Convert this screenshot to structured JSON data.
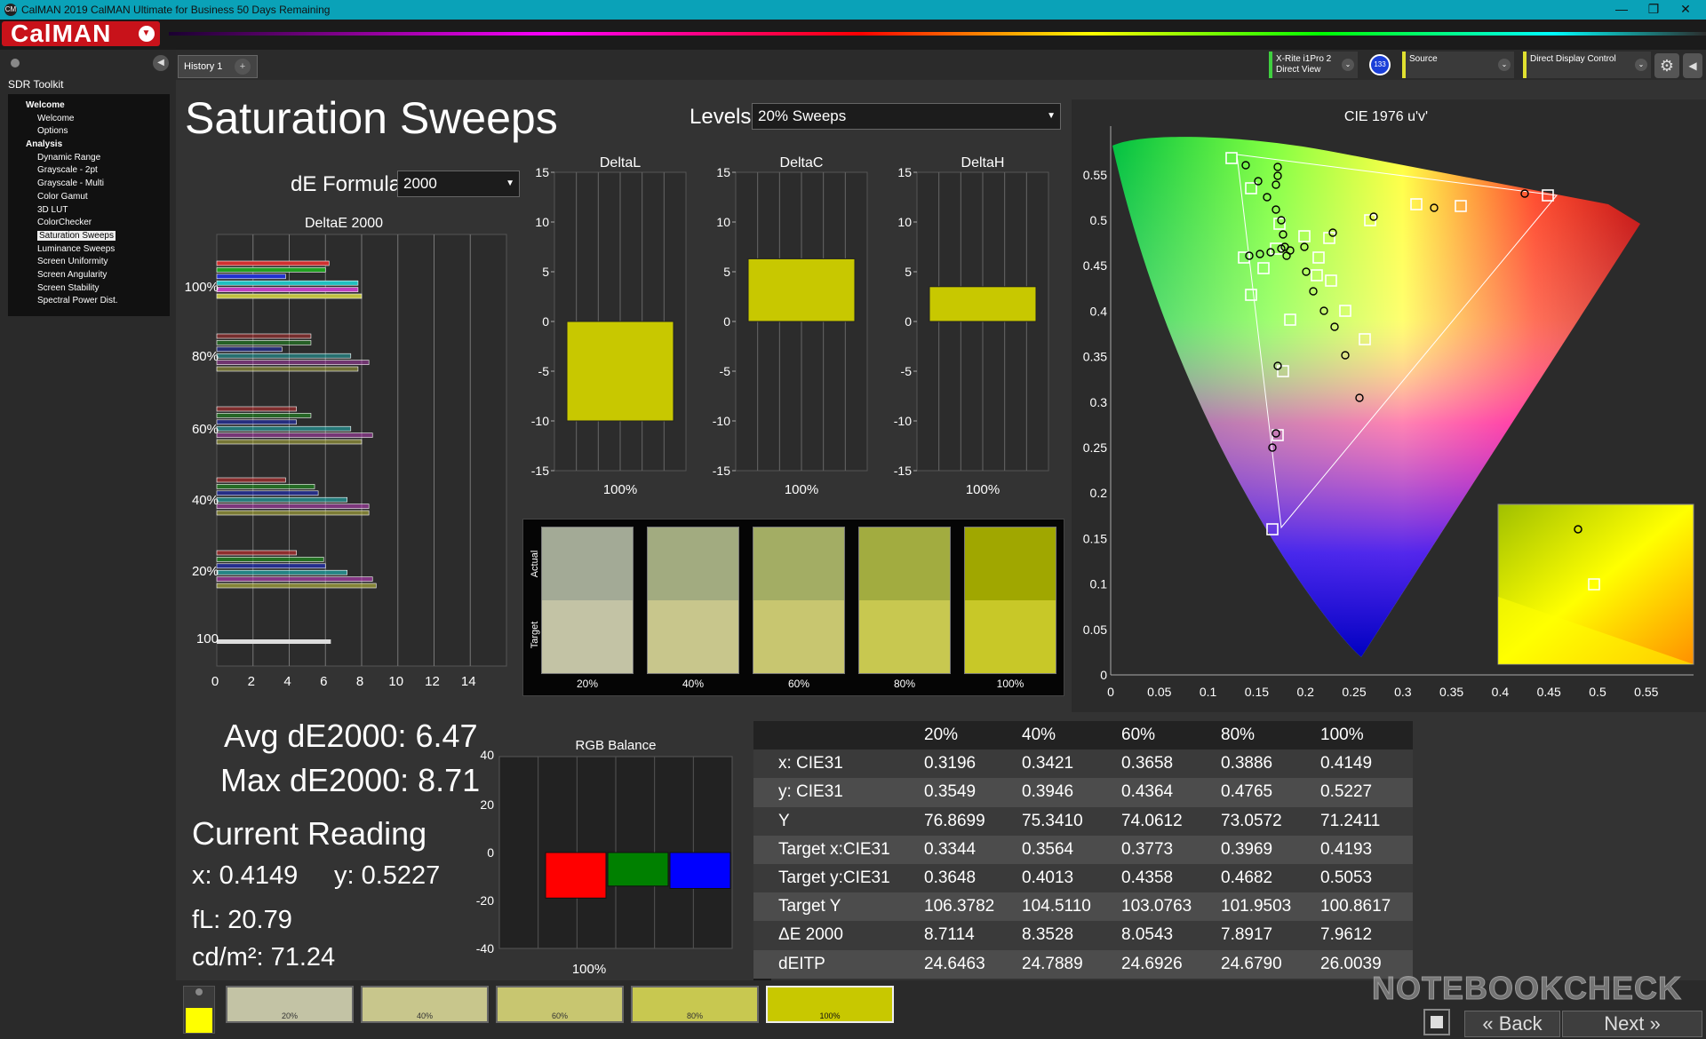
{
  "window": {
    "title": "CalMAN 2019 CalMAN Ultimate for Business 50 Days Remaining",
    "icon_text": "CM",
    "min": "—",
    "max": "❐",
    "close": "✕"
  },
  "app": {
    "logo": "CalMAN"
  },
  "sidebar": {
    "header": "SDR Toolkit",
    "items": [
      {
        "label": "Welcome",
        "level": "h"
      },
      {
        "label": "Welcome",
        "level": "i"
      },
      {
        "label": "Options",
        "level": "i"
      },
      {
        "label": "Analysis",
        "level": "h"
      },
      {
        "label": "Dynamic Range",
        "level": "i"
      },
      {
        "label": "Grayscale - 2pt",
        "level": "i"
      },
      {
        "label": "Grayscale - Multi",
        "level": "i"
      },
      {
        "label": "Color Gamut",
        "level": "i"
      },
      {
        "label": "3D LUT",
        "level": "i"
      },
      {
        "label": "ColorChecker",
        "level": "i"
      },
      {
        "label": "Saturation Sweeps",
        "level": "i",
        "selected": true
      },
      {
        "label": "Luminance Sweeps",
        "level": "i"
      },
      {
        "label": "Screen Uniformity",
        "level": "i"
      },
      {
        "label": "Screen Angularity",
        "level": "i"
      },
      {
        "label": "Screen Stability",
        "level": "i"
      },
      {
        "label": "Spectral Power Dist.",
        "level": "i"
      }
    ]
  },
  "tabs": {
    "history": "History 1",
    "add": "+"
  },
  "devices": {
    "meter": "X-Rite i1Pro 2\nDirect View",
    "meter_badge": "133",
    "source": "Source",
    "display": "Direct Display Control",
    "meter_color": "#3fcf3f",
    "source_color": "#e0e030",
    "display_color": "#e0e030"
  },
  "page": {
    "title": "Saturation Sweeps",
    "levels_label": "Levels:",
    "levels_value": "20% Sweeps",
    "de_formula_label": "dE Formula:",
    "de_formula_value": "2000"
  },
  "deltae_chart": {
    "title": "DeltaE 2000",
    "row_labels": [
      "100%",
      "80%",
      "60%",
      "40%",
      "20%",
      "100"
    ],
    "xticks": [
      "0",
      "2",
      "4",
      "6",
      "8",
      "10",
      "12",
      "14"
    ]
  },
  "delta_charts": [
    {
      "title": "DeltaL",
      "value": -10,
      "label": "100%"
    },
    {
      "title": "DeltaC",
      "value": 6.3,
      "label": "100%"
    },
    {
      "title": "DeltaH",
      "value": 3.5,
      "label": "100%"
    }
  ],
  "delta_yticks": [
    "15",
    "10",
    "5",
    "0",
    "-5",
    "-10",
    "-15"
  ],
  "swatches": {
    "actual_label": "Actual",
    "target_label": "Target",
    "items": [
      {
        "label": "20%",
        "actual": "#a3aa96",
        "target": "#c3c3a5"
      },
      {
        "label": "40%",
        "actual": "#a2ab80",
        "target": "#c8c68c"
      },
      {
        "label": "60%",
        "actual": "#a3ad64",
        "target": "#c8c670"
      },
      {
        "label": "80%",
        "actual": "#a2ac40",
        "target": "#c8c850"
      },
      {
        "label": "100%",
        "actual": "#a0a700",
        "target": "#c8c828"
      }
    ]
  },
  "cie": {
    "title": "CIE 1976 u'v'",
    "xticks": [
      "0",
      "0.05",
      "0.1",
      "0.15",
      "0.2",
      "0.25",
      "0.3",
      "0.35",
      "0.4",
      "0.45",
      "0.5",
      "0.55"
    ],
    "yticks": [
      "0",
      "0.05",
      "0.1",
      "0.15",
      "0.2",
      "0.25",
      "0.3",
      "0.35",
      "0.4",
      "0.45",
      "0.5",
      "0.55"
    ]
  },
  "stats": {
    "avg": "Avg dE2000: 6.47",
    "max": "Max dE2000: 8.71",
    "current": "Current Reading",
    "x": "x: 0.4149",
    "y": "y: 0.5227",
    "fl": "fL: 20.79",
    "cdm": "cd/m²: 71.24"
  },
  "rgb_balance": {
    "title": "RGB Balance",
    "yticks": [
      "40",
      "20",
      "0",
      "-20",
      "-40"
    ],
    "label": "100%"
  },
  "table": {
    "headers": [
      "",
      "20%",
      "40%",
      "60%",
      "80%",
      "100%"
    ],
    "rows": [
      [
        "x: CIE31",
        "0.3196",
        "0.3421",
        "0.3658",
        "0.3886",
        "0.4149"
      ],
      [
        "y: CIE31",
        "0.3549",
        "0.3946",
        "0.4364",
        "0.4765",
        "0.5227"
      ],
      [
        "Y",
        "76.8699",
        "75.3410",
        "74.0612",
        "73.0572",
        "71.2411"
      ],
      [
        "Target x:CIE31",
        "0.3344",
        "0.3564",
        "0.3773",
        "0.3969",
        "0.4193"
      ],
      [
        "Target y:CIE31",
        "0.3648",
        "0.4013",
        "0.4358",
        "0.4682",
        "0.5053"
      ],
      [
        "Target Y",
        "106.3782",
        "104.5110",
        "103.0763",
        "101.9503",
        "100.8617"
      ],
      [
        "ΔE 2000",
        "8.7114",
        "8.3528",
        "8.0543",
        "7.8917",
        "7.9612"
      ],
      [
        "dEITP",
        "24.6463",
        "24.7889",
        "24.6926",
        "24.6790",
        "26.0039"
      ]
    ]
  },
  "bottom": {
    "swatch_labels": [
      "20%",
      "40%",
      "60%",
      "80%",
      "100%"
    ],
    "swatch_colors": [
      "#c3c3a5",
      "#c8c68c",
      "#c8c670",
      "#c8c850",
      "#c8c828"
    ],
    "back": "Back",
    "next": "Next",
    "watermark": "NOTEBOOKCHECK"
  },
  "chart_data": [
    {
      "type": "bar",
      "title": "DeltaE 2000",
      "categories": [
        "20%",
        "40%",
        "60%",
        "80%",
        "100%"
      ],
      "series": [
        {
          "name": "ΔE 2000",
          "values": [
            8.71,
            8.35,
            8.05,
            7.89,
            7.96
          ]
        }
      ],
      "xlim": [
        0,
        14
      ]
    },
    {
      "type": "bar",
      "title": "DeltaL",
      "categories": [
        "100%"
      ],
      "values": [
        -10
      ],
      "ylim": [
        -15,
        15
      ]
    },
    {
      "type": "bar",
      "title": "DeltaC",
      "categories": [
        "100%"
      ],
      "values": [
        6.3
      ],
      "ylim": [
        -15,
        15
      ]
    },
    {
      "type": "bar",
      "title": "DeltaH",
      "categories": [
        "100%"
      ],
      "values": [
        3.5
      ],
      "ylim": [
        -15,
        15
      ]
    },
    {
      "type": "bar",
      "title": "RGB Balance",
      "categories": [
        "Red",
        "Green",
        "Blue"
      ],
      "values": [
        -19,
        -14,
        -15
      ],
      "ylim": [
        -40,
        40
      ],
      "colors": [
        "#ff0000",
        "#008000",
        "#0000ff"
      ]
    },
    {
      "type": "scatter",
      "title": "CIE 1976 u'v'",
      "xlim": [
        0,
        0.6
      ],
      "ylim": [
        0,
        0.6
      ]
    }
  ]
}
